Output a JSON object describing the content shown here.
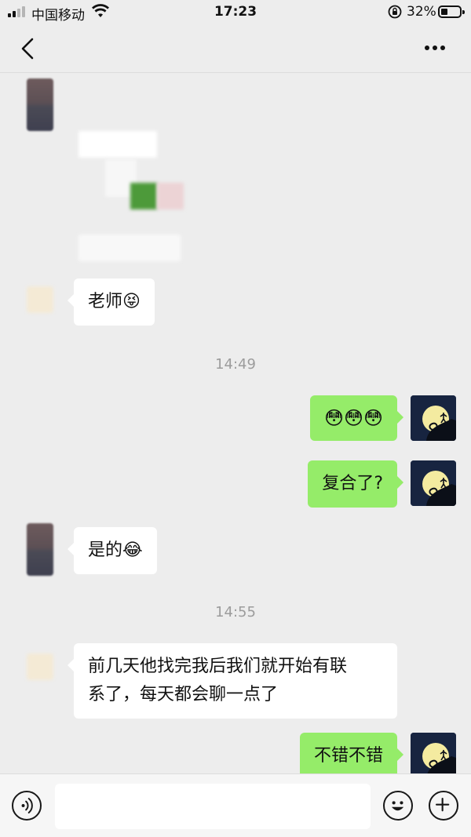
{
  "status_bar": {
    "carrier": "中国移动",
    "time": "17:23",
    "battery": "32%"
  },
  "messages": [
    {
      "side": "left",
      "text": "老师😝"
    },
    {
      "type": "time",
      "text": "14:49"
    },
    {
      "side": "right",
      "text": "😳😳😳"
    },
    {
      "side": "right",
      "text": "复合了?"
    },
    {
      "side": "left",
      "text": "是的😂"
    },
    {
      "type": "time",
      "text": "14:55"
    },
    {
      "side": "left",
      "text": "前几天他找完我后我们就开始有联\n系了，每天都会聊一点了"
    },
    {
      "side": "right",
      "text": "不错不错"
    }
  ],
  "colors": {
    "background": "#ededed",
    "bubble_out": "#95ec69",
    "bubble_in": "#ffffff"
  },
  "icons": [
    "back-icon",
    "more-icon",
    "voice-icon",
    "emoji-icon",
    "plus-icon"
  ]
}
